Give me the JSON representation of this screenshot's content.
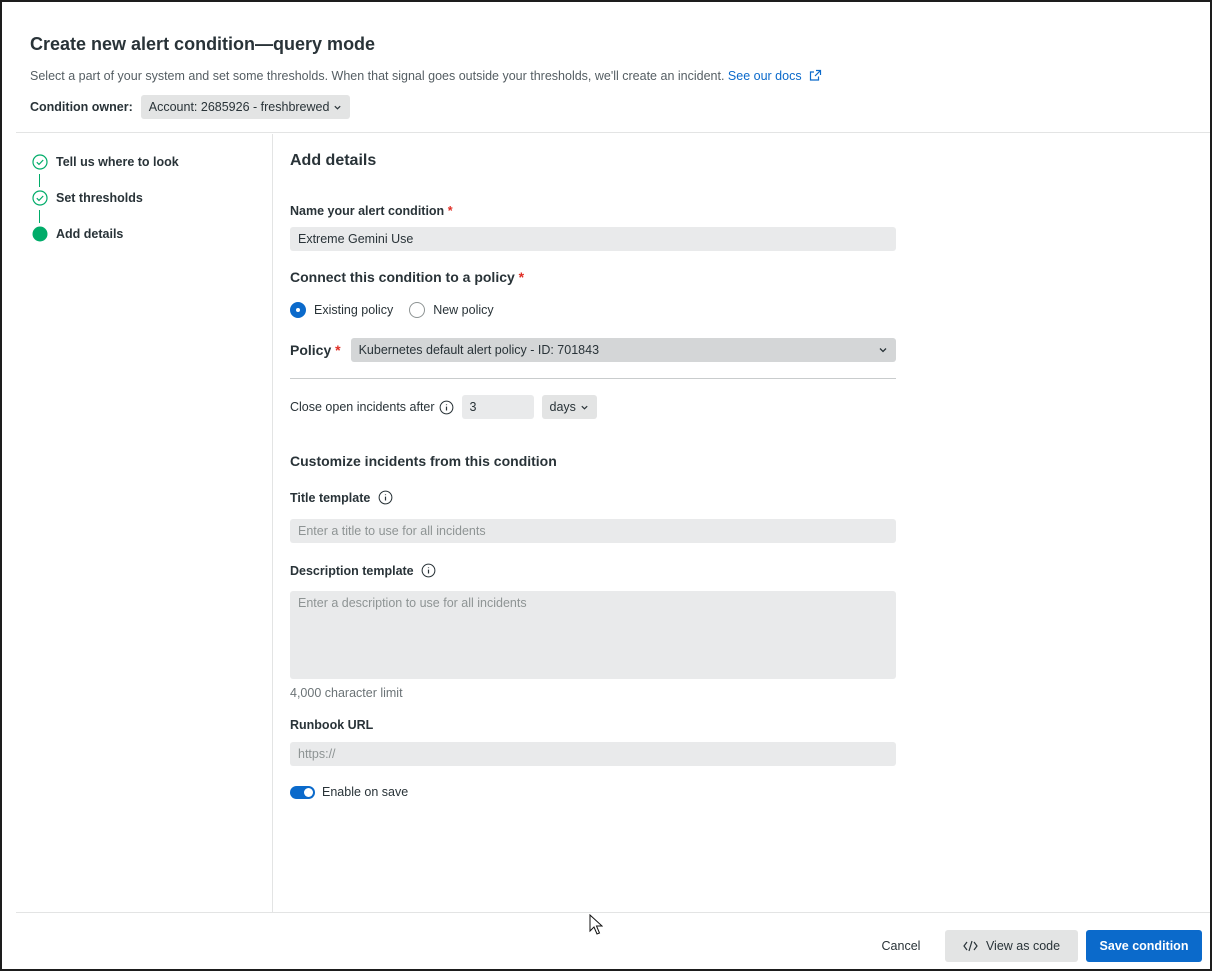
{
  "header": {
    "title": "Create new alert condition—query mode",
    "subtitle": "Select a part of your system and set some thresholds. When that signal goes outside your thresholds, we'll create an incident.",
    "docs_link": "See our docs",
    "owner_label": "Condition owner:",
    "owner_value": "Account: 2685926 - freshbrewed"
  },
  "sidebar": {
    "steps": [
      {
        "label": "Tell us where to look",
        "state": "complete",
        "icon": "check-circle-icon"
      },
      {
        "label": "Set thresholds",
        "state": "complete",
        "icon": "check-circle-icon"
      },
      {
        "label": "Add details",
        "state": "current",
        "icon": "filled-dot-icon"
      }
    ]
  },
  "main": {
    "heading": "Add details",
    "name_label": "Name your alert condition",
    "name_value": "Extreme Gemini Use",
    "policy_section": "Connect this condition to a policy",
    "radio_existing": "Existing policy",
    "radio_new": "New policy",
    "policy_label": "Policy",
    "policy_value": "Kubernetes default alert policy - ID: 701843",
    "close_label": "Close open incidents after",
    "close_value": "3",
    "close_unit": "days",
    "customize_title": "Customize incidents from this condition",
    "title_template_label": "Title template",
    "title_template_placeholder": "Enter a title to use for all incidents",
    "description_label": "Description template",
    "description_placeholder": "Enter a description to use for all incidents",
    "char_limit": "4,000 character limit",
    "runbook_label": "Runbook URL",
    "runbook_placeholder": "https://",
    "enable_label": "Enable on save",
    "enable_on": true
  },
  "footer": {
    "cancel": "Cancel",
    "view_code": "View as code",
    "save": "Save condition"
  },
  "colors": {
    "accent": "#0b6acb",
    "success": "#00ac69",
    "required": "#df2d24"
  }
}
